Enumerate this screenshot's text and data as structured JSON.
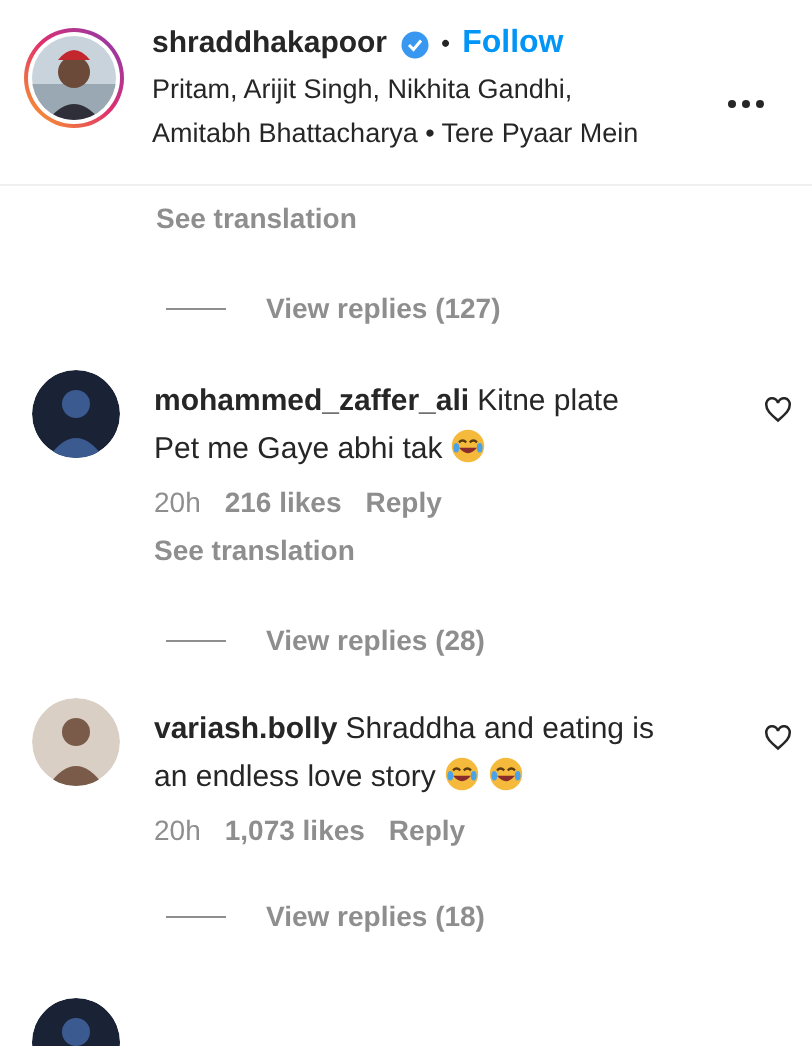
{
  "post_header": {
    "username": "shraddhakapoor",
    "verified": true,
    "separator": "•",
    "follow": "Follow",
    "subtitle_lines": [
      "Pritam, Arijit Singh, Nikhita Gandhi,",
      "Amitabh Bhattacharya • Tere Pyaar Mein"
    ]
  },
  "caption_footer": {
    "see_translation": "See translation",
    "view_replies": "View replies (127)"
  },
  "comments": [
    {
      "username": "mohammed_zaffer_ali",
      "text_lines": [
        "Kitne plate",
        "Pet me Gaye abhi tak"
      ],
      "emojis": [
        {
          "kind": "laughing"
        }
      ],
      "liked": false,
      "time": "20h",
      "likes": "216 likes",
      "reply": "Reply",
      "see_translation": "See translation",
      "view_replies": "View replies (28)"
    },
    {
      "username": "variash.bolly",
      "text_lines": [
        "Shraddha and eating is",
        "an endless love story"
      ],
      "emojis": [
        {
          "kind": "laughing"
        },
        {
          "kind": "laughing"
        }
      ],
      "liked": false,
      "time": "20h",
      "likes": "1,073 likes",
      "reply": "Reply",
      "view_replies": "View replies (18)"
    }
  ]
}
